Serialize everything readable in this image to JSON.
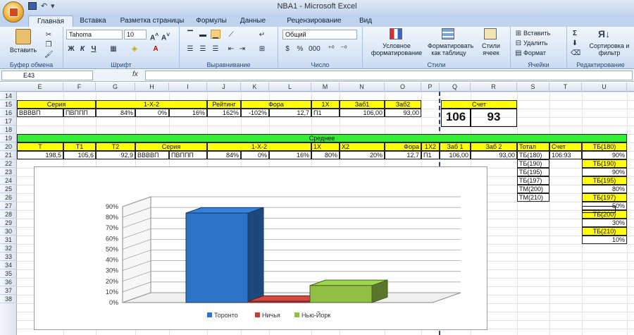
{
  "window": {
    "title": "NBA1 - Microsoft Excel"
  },
  "tabs": [
    "Главная",
    "Вставка",
    "Разметка страницы",
    "Формулы",
    "Данные",
    "Рецензирование",
    "Вид"
  ],
  "ribbon": {
    "paste_label": "Вставить",
    "clipboard_label": "Буфер обмена",
    "font_name": "Tahoma",
    "font_size": "10",
    "font_label": "Шрифт",
    "bold": "Ж",
    "italic": "К",
    "underline": "Ч",
    "align_label": "Выравнивание",
    "number_format": "Общий",
    "number_label": "Число",
    "cond_format": "Условное форматирование",
    "format_table": "Форматировать как таблицу",
    "cell_styles": "Стили ячеек",
    "styles_label": "Стили",
    "insert": "Вставить",
    "delete": "Удалить",
    "format": "Формат",
    "cells_label": "Ячейки",
    "sort_filter": "Сортировка и фильтр",
    "editing_label": "Редактирование"
  },
  "formula_bar": {
    "name_box": "E43",
    "fx": "fx"
  },
  "columns": [
    "E",
    "F",
    "G",
    "H",
    "I",
    "J",
    "K",
    "L",
    "M",
    "N",
    "O",
    "P",
    "Q",
    "R",
    "S",
    "T",
    "U"
  ],
  "rows": [
    "14",
    "15",
    "16",
    "17",
    "18",
    "19",
    "20",
    "21",
    "22",
    "23",
    "24",
    "25",
    "26",
    "27",
    "28",
    "29",
    "30",
    "31",
    "32",
    "33",
    "34",
    "35",
    "36",
    "37",
    "38"
  ],
  "row15": {
    "seria": "Серия",
    "x12": "1-X-2",
    "rating": "Рейтинг",
    "fora": "Фора",
    "p1x": "1X",
    "zab1": "Заб1",
    "zab2": "Заб2",
    "schet": "Счет"
  },
  "row16": {
    "e": "ВВВВП",
    "f": "ПВППП",
    "g": "84%",
    "h": "0%",
    "i": "16%",
    "j": "162%",
    "k": "-102%",
    "l": "12,7",
    "m": "П1",
    "n": "106,00",
    "o": "93,00"
  },
  "score": {
    "home": "106",
    "away": "93"
  },
  "row19": {
    "title": "Среднее"
  },
  "row20": {
    "t": "Т",
    "t1": "Т1",
    "t2": "Т2",
    "seria": "Серия",
    "x12": "1-X-2",
    "p1x": "1X",
    "x2": "X2",
    "fora": "Фора",
    "p12": "1X2",
    "zab1": "Заб 1",
    "zab2": "Заб 2",
    "total": "Тотал",
    "schet": "Счет",
    "tb180": "ТБ(180)"
  },
  "row21": {
    "t": "198,5",
    "t1": "105,6",
    "t2": "92,9",
    "s1": "ВВВВП",
    "s2": "ПВППП",
    "v1": "84%",
    "v2": "0%",
    "v3": "16%",
    "v4": "80%",
    "v5": "20%",
    "fora": "12,7",
    "p1": "П1",
    "z1": "106,00",
    "z2": "93,00",
    "total": "ТБ(180)",
    "schet": "106:93",
    "u": "90%"
  },
  "totals_list": [
    "ТБ(190)",
    "ТБ(195)",
    "ТБ(197)",
    "ТМ(200)",
    "ТМ(210)"
  ],
  "u_column": [
    {
      "label": "ТБ(190)",
      "value": "90%"
    },
    {
      "label": "ТБ(195)",
      "value": "80%"
    },
    {
      "label": "ТБ(197)",
      "value": "50%"
    },
    {
      "label": "ТБ(200)",
      "value": "30%"
    },
    {
      "label": "ТБ(210)",
      "value": "10%"
    }
  ],
  "chart_data": {
    "type": "bar",
    "categories": [
      ""
    ],
    "series": [
      {
        "name": "Торонто",
        "values": [
          84
        ],
        "color": "#2e74c6"
      },
      {
        "name": "Ничья",
        "values": [
          0
        ],
        "color": "#c0403a"
      },
      {
        "name": "Нью-Йорк",
        "values": [
          16
        ],
        "color": "#8fbf45"
      }
    ],
    "yticks": [
      "0%",
      "10%",
      "20%",
      "30%",
      "40%",
      "50%",
      "60%",
      "70%",
      "80%",
      "90%"
    ],
    "ylim": [
      0,
      90
    ],
    "grid": true,
    "legend": "bottom",
    "three_d": true
  }
}
